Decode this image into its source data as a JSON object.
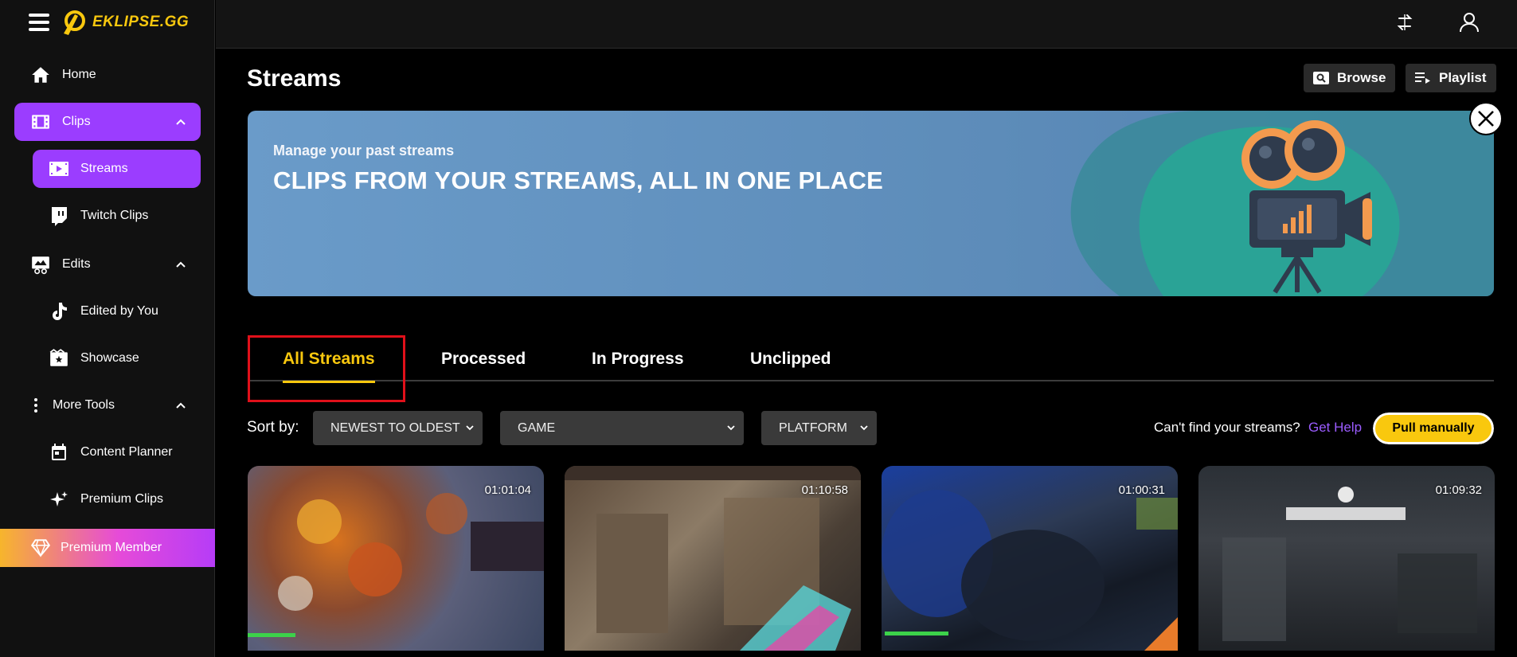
{
  "brand": {
    "name": "EKLIPSE.GG",
    "accent": "#f9c80e",
    "purple": "#9b3dff"
  },
  "sidebar": {
    "items": [
      {
        "label": "Home",
        "icon": "home-icon"
      },
      {
        "label": "Clips",
        "icon": "film-icon"
      },
      {
        "label": "Streams",
        "icon": "video-icon"
      },
      {
        "label": "Twitch Clips",
        "icon": "twitch-icon"
      },
      {
        "label": "Edits",
        "icon": "edit-icon"
      },
      {
        "label": "Edited by You",
        "icon": "tiktok-icon"
      },
      {
        "label": "Showcase",
        "icon": "showcase-icon"
      },
      {
        "label": "More Tools",
        "icon": "more-vertical-icon"
      },
      {
        "label": "Content Planner",
        "icon": "calendar-icon"
      },
      {
        "label": "Premium Clips",
        "icon": "sparkle-icon"
      }
    ],
    "premium_label": "Premium Member"
  },
  "header": {
    "title": "Streams",
    "browse_label": "Browse",
    "playlist_label": "Playlist"
  },
  "banner": {
    "subtitle": "Manage your past streams",
    "title": "CLIPS FROM YOUR STREAMS, ALL IN ONE PLACE"
  },
  "tabs": [
    {
      "label": "All Streams",
      "active": true
    },
    {
      "label": "Processed",
      "active": false
    },
    {
      "label": "In Progress",
      "active": false
    },
    {
      "label": "Unclipped",
      "active": false
    }
  ],
  "filters": {
    "sort_label": "Sort by:",
    "sort_value": "NEWEST TO OLDEST",
    "game_value": "GAME",
    "platform_value": "PLATFORM",
    "help_text": "Can't find your streams?",
    "help_link": "Get Help",
    "pull_label": "Pull manually"
  },
  "streams": [
    {
      "duration": "01:01:04"
    },
    {
      "duration": "01:10:58"
    },
    {
      "duration": "01:00:31"
    },
    {
      "duration": "01:09:32"
    }
  ]
}
